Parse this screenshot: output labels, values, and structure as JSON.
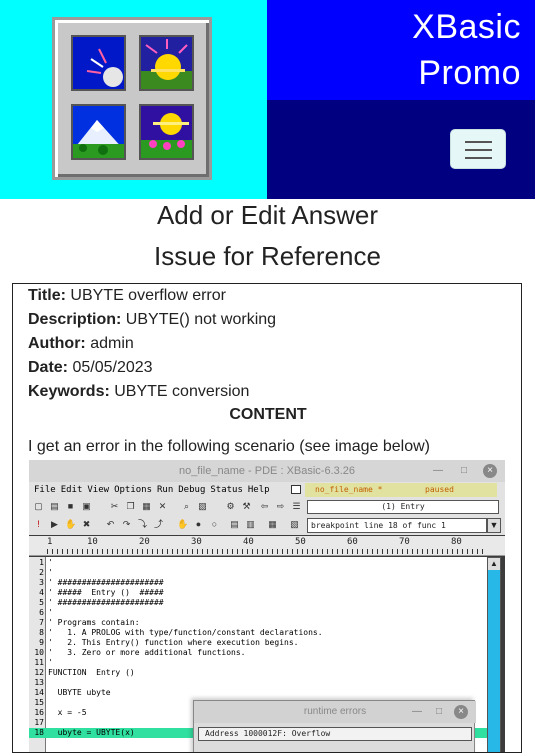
{
  "header": {
    "brand_line1": "XBasic",
    "brand_line2": "Promo",
    "colors": {
      "logo_bg": "#00ffff",
      "brand_bg": "#0000ff",
      "nav_bg": "#000080"
    },
    "menu_icon": "hamburger-icon"
  },
  "page": {
    "title": "Add or Edit Answer",
    "subtitle": "Issue for Reference"
  },
  "issue": {
    "title_label": "Title:",
    "title_value": "UBYTE overflow error",
    "description_label": "Description:",
    "description_value": "UBYTE() not working",
    "author_label": "Author:",
    "author_value": "admin",
    "date_label": "Date:",
    "date_value": "05/05/2023",
    "keywords_label": "Keywords:",
    "keywords_value": "UBYTE conversion",
    "content_heading": "CONTENT",
    "content_intro": "I get an error in the following scenario (see image below)"
  },
  "ide": {
    "window_title": "no_file_name - PDE : XBasic-6.3.26",
    "menus": [
      "File",
      "Edit",
      "View",
      "Options",
      "Run",
      "Debug",
      "Status",
      "Help"
    ],
    "file_name": "no_file_name *",
    "run_status": "paused",
    "function_box": "(1) Entry",
    "breakpoint_box": "breakpoint line 18 of func 1",
    "ruler": [
      "1",
      "10",
      "20",
      "30",
      "40",
      "50",
      "60",
      "70",
      "80"
    ],
    "lines": [
      {
        "n": "1",
        "t": "'"
      },
      {
        "n": "2",
        "t": "'"
      },
      {
        "n": "3",
        "t": "' ######################"
      },
      {
        "n": "4",
        "t": "' #####  Entry ()  #####"
      },
      {
        "n": "5",
        "t": "' ######################"
      },
      {
        "n": "6",
        "t": "'"
      },
      {
        "n": "7",
        "t": "' Programs contain:"
      },
      {
        "n": "8",
        "t": "'   1. A PROLOG with type/function/constant declarations."
      },
      {
        "n": "9",
        "t": "'   2. This Entry() function where execution begins."
      },
      {
        "n": "10",
        "t": "'   3. Zero or more additional functions."
      },
      {
        "n": "11",
        "t": "'"
      },
      {
        "n": "12",
        "t": "FUNCTION  Entry ()"
      },
      {
        "n": "13",
        "t": ""
      },
      {
        "n": "14",
        "t": "  UBYTE ubyte"
      },
      {
        "n": "15",
        "t": ""
      },
      {
        "n": "16",
        "t": "  x = -5"
      },
      {
        "n": "17",
        "t": ""
      },
      {
        "n": "18",
        "t": "  ubyte = UBYTE(x)"
      }
    ],
    "runtime_title": "runtime errors",
    "runtime_message": "Address 1000012F:  Overflow"
  }
}
